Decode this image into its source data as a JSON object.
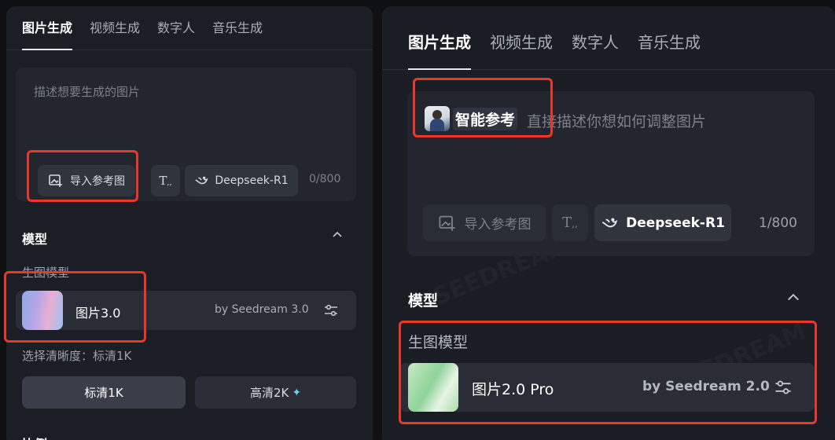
{
  "left": {
    "tabs": [
      "图片生成",
      "视频生成",
      "数字人",
      "音乐生成"
    ],
    "prompt": {
      "placeholder": "描述想要生成的图片",
      "import_label": "导入参考图",
      "deepseek_label": "Deepseek-R1",
      "counter": "0/800"
    },
    "model_section": {
      "title": "模型",
      "sub_label": "生图模型",
      "name": "图片3.0",
      "by": "by Seedream 3.0"
    },
    "resolution": {
      "label": "选择清晰度：标清1K",
      "options": [
        "标清1K",
        "高清2K"
      ],
      "selected": "标清1K",
      "sparkle": "✦"
    },
    "ratio_label": "比例"
  },
  "right": {
    "tabs": [
      "图片生成",
      "视频生成",
      "数字人",
      "音乐生成"
    ],
    "prompt": {
      "tag_label": "智能参考",
      "placeholder": "直接描述你想如何调整图片",
      "import_label": "导入参考图",
      "deepseek_label": "Deepseek-R1",
      "counter": "1/800"
    },
    "model_section": {
      "title": "模型",
      "sub_label": "生图模型",
      "name": "图片2.0 Pro",
      "by": "by Seedream 2.0"
    }
  },
  "colors": {
    "highlight": "#e8372b",
    "sparkle": "#5fd3f3"
  },
  "icons": [
    "import-image-icon",
    "text-format-icon",
    "deepseek-whale-icon",
    "chevron-up-icon",
    "sliders-icon",
    "sparkle-icon"
  ]
}
